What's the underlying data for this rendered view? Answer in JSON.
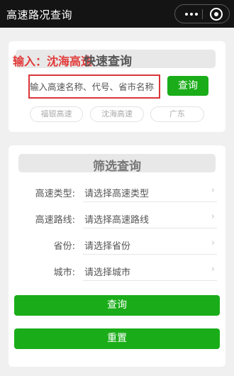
{
  "app": {
    "title": "高速路况查询"
  },
  "quick_search": {
    "annotation_prefix": "输入：",
    "annotation_highlight": "沈海高速",
    "title": "快速查询",
    "placeholder": "输入高速名称、代号、省市名称",
    "search_label": "查询",
    "chips": [
      "福银高速",
      "沈海高速",
      "广东"
    ]
  },
  "filter": {
    "title": "筛选查询",
    "fields": [
      {
        "label": "高速类型:",
        "placeholder": "请选择高速类型",
        "chevron": "›"
      },
      {
        "label": "高速路线:",
        "placeholder": "请选择高速路线",
        "chevron": "›"
      },
      {
        "label": "省份:",
        "placeholder": "请选择省份",
        "chevron": "›"
      },
      {
        "label": "城市:",
        "placeholder": "请选择城市",
        "chevron": "›"
      }
    ],
    "query_label": "查询",
    "reset_label": "重置"
  },
  "colors": {
    "primary": "#1aad19",
    "annotation": "#e23a3a",
    "titlebar": "#141414"
  },
  "icons": {
    "capsule_more": "more-dots-icon",
    "capsule_close": "close-target-icon",
    "field_arrow": "chevron-right-icon"
  }
}
